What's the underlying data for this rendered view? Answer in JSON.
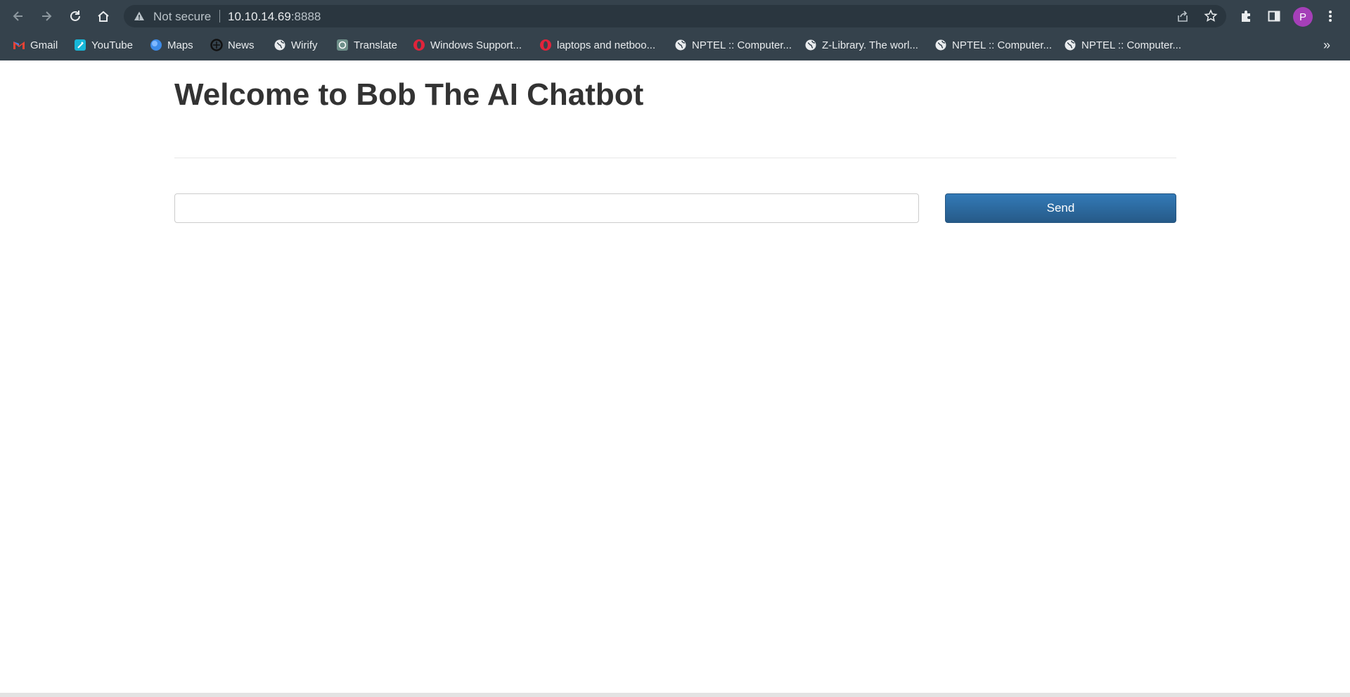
{
  "browser": {
    "address": {
      "security_label": "Not secure",
      "host": "10.10.14.69",
      "port": ":8888"
    },
    "profile_initial": "P",
    "bookmarks": [
      {
        "label": "Gmail",
        "icon": "gmail-icon"
      },
      {
        "label": "YouTube",
        "icon": "youtube-icon"
      },
      {
        "label": "Maps",
        "icon": "maps-icon"
      },
      {
        "label": "News",
        "icon": "news-icon"
      },
      {
        "label": "Wirify",
        "icon": "globe-icon"
      },
      {
        "label": "Translate",
        "icon": "translate-icon"
      },
      {
        "label": "Windows Support...",
        "icon": "opera-icon"
      },
      {
        "label": "laptops and netboo...",
        "icon": "opera-icon"
      },
      {
        "label": "NPTEL :: Computer...",
        "icon": "globe-icon"
      },
      {
        "label": "Z-Library. The worl...",
        "icon": "globe-icon"
      },
      {
        "label": "NPTEL :: Computer...",
        "icon": "globe-icon"
      },
      {
        "label": "NPTEL :: Computer...",
        "icon": "globe-icon"
      }
    ],
    "more_bookmarks": "»"
  },
  "page": {
    "title": "Welcome to Bob The AI Chatbot",
    "message_input": {
      "value": "",
      "placeholder": ""
    },
    "send_label": "Send"
  },
  "colors": {
    "chrome": "#35424c",
    "button": "#337ab7",
    "title_text": "#333333"
  }
}
